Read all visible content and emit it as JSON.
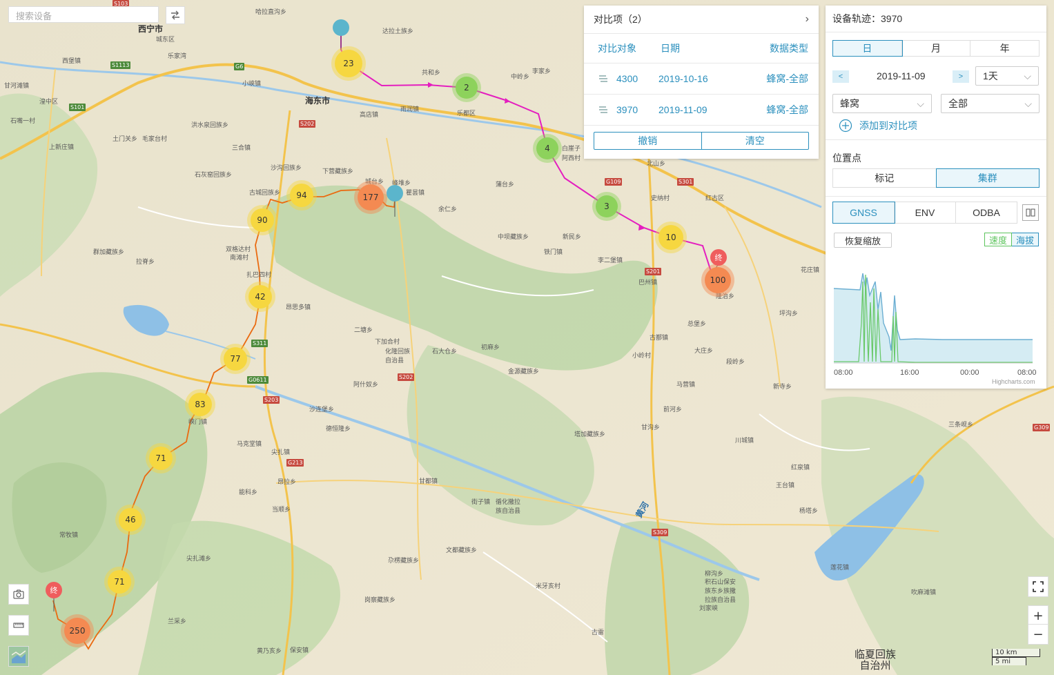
{
  "search": {
    "placeholder": "搜索设备"
  },
  "compare": {
    "title": "对比项（2）",
    "columns": [
      "对比对象",
      "日期",
      "数据类型"
    ],
    "rows": [
      {
        "device": "4300",
        "date": "2019-10-16",
        "type": "蜂窝-全部"
      },
      {
        "device": "3970",
        "date": "2019-11-09",
        "type": "蜂窝-全部"
      }
    ],
    "undo_label": "撤销",
    "clear_label": "清空"
  },
  "track": {
    "title": "设备轨迹：3970",
    "period_tabs": [
      "日",
      "月",
      "年"
    ],
    "date": "2019-11-09",
    "prev_label": "<",
    "next_label": ">",
    "span_value": "1天",
    "source_value": "蜂窝",
    "filter_value": "全部",
    "add_label": "添加到对比项",
    "points_title": "位置点",
    "point_modes": [
      "标记",
      "集群"
    ],
    "sensor_tabs": [
      "GNSS",
      "ENV",
      "ODBA"
    ],
    "reset_zoom": "恢复缩放",
    "metric_speed": "速度",
    "metric_altitude": "海拔",
    "x_ticks": [
      "08:00",
      "16:00",
      "00:00",
      "08:00"
    ],
    "credit": "Highcharts.com"
  },
  "map": {
    "clusters_a": [
      {
        "label": "23"
      },
      {
        "label": "2"
      },
      {
        "label": "4"
      },
      {
        "label": "3"
      },
      {
        "label": "10"
      },
      {
        "label": "100"
      }
    ],
    "clusters_b": [
      {
        "label": "177"
      },
      {
        "label": "94"
      },
      {
        "label": "90"
      },
      {
        "label": "42"
      },
      {
        "label": "77"
      },
      {
        "label": "83"
      },
      {
        "label": "71"
      },
      {
        "label": "46"
      },
      {
        "label": "71"
      },
      {
        "label": "250"
      }
    ],
    "end_label": "终",
    "cities": [
      "西宁市",
      "海东市",
      "城东区",
      "乐都区",
      "黄河"
    ],
    "prefecture": "临夏回族\n自治州",
    "towns": [
      "哈拉直沟乡",
      "达拉土族乡",
      "共和乡",
      "中岭乡",
      "李家乡",
      "高店镇",
      "雨润镇",
      "乐家湾",
      "小峡镇",
      "西堡镇",
      "甘河滩镇",
      "湟中区",
      "石嘴一村",
      "洪水泉回族乡",
      "土门关乡",
      "毛家台村",
      "上新庄镇",
      "三合镇",
      "沙沟回族乡",
      "石灰窑回族乡",
      "下营藏族乡",
      "古城回族乡",
      "城台乡",
      "峰堆乡",
      "瞿昙镇",
      "蒲台乡",
      "余仁乡",
      "白崖子",
      "阿西村",
      "北山乡",
      "史纳村",
      "红古区",
      "中坝藏族乡",
      "新民乡",
      "铁门镇",
      "李二堡镇",
      "巴州镇",
      "隆治乡",
      "群加藏族乡",
      "拉脊乡",
      "双格达村",
      "南滩村",
      "扎巴四村",
      "昂思多镇",
      "二塘乡",
      "下加合村",
      "化隆回族自治县",
      "石大仓乡",
      "初麻乡",
      "金源藏族乡",
      "阿什奴乡",
      "甘都镇",
      "塔加藏族乡",
      "峡门镇",
      "沙连堡乡",
      "德恒隆乡",
      "马克堂镇",
      "尖扎镇",
      "昂拉乡",
      "能科乡",
      "当顺乡",
      "尖扎滩乡",
      "常牧镇",
      "文都藏族乡",
      "尕楞藏族乡",
      "米牙亥村",
      "古雷",
      "岗察藏族乡",
      "街子镇",
      "循化撒拉族自治县",
      "积石山保安族东乡族撒拉族自治县",
      "刘家峡",
      "莲花镇",
      "三条岘乡",
      "王台镇",
      "红泉镇",
      "杨塔乡",
      "吹麻滩镇",
      "柳沟乡",
      "新寺乡",
      "川城镇",
      "甘沟乡",
      "前河乡",
      "大庄乡",
      "段岭乡",
      "马营镇",
      "总堡乡",
      "坪沟乡",
      "花庄镇",
      "小岭村",
      "古鄯镇",
      "保安镇",
      "黄乃亥乡",
      "兰采乡"
    ],
    "roads": [
      "S103",
      "G6",
      "S1113",
      "S101",
      "S202",
      "G109",
      "S301",
      "S201",
      "S203",
      "S311",
      "G0611",
      "G213",
      "S309",
      "G309",
      "S202"
    ],
    "scale_km": "10 km",
    "scale_mi": "5 mi",
    "zoom_in": "+",
    "zoom_out": "−"
  }
}
